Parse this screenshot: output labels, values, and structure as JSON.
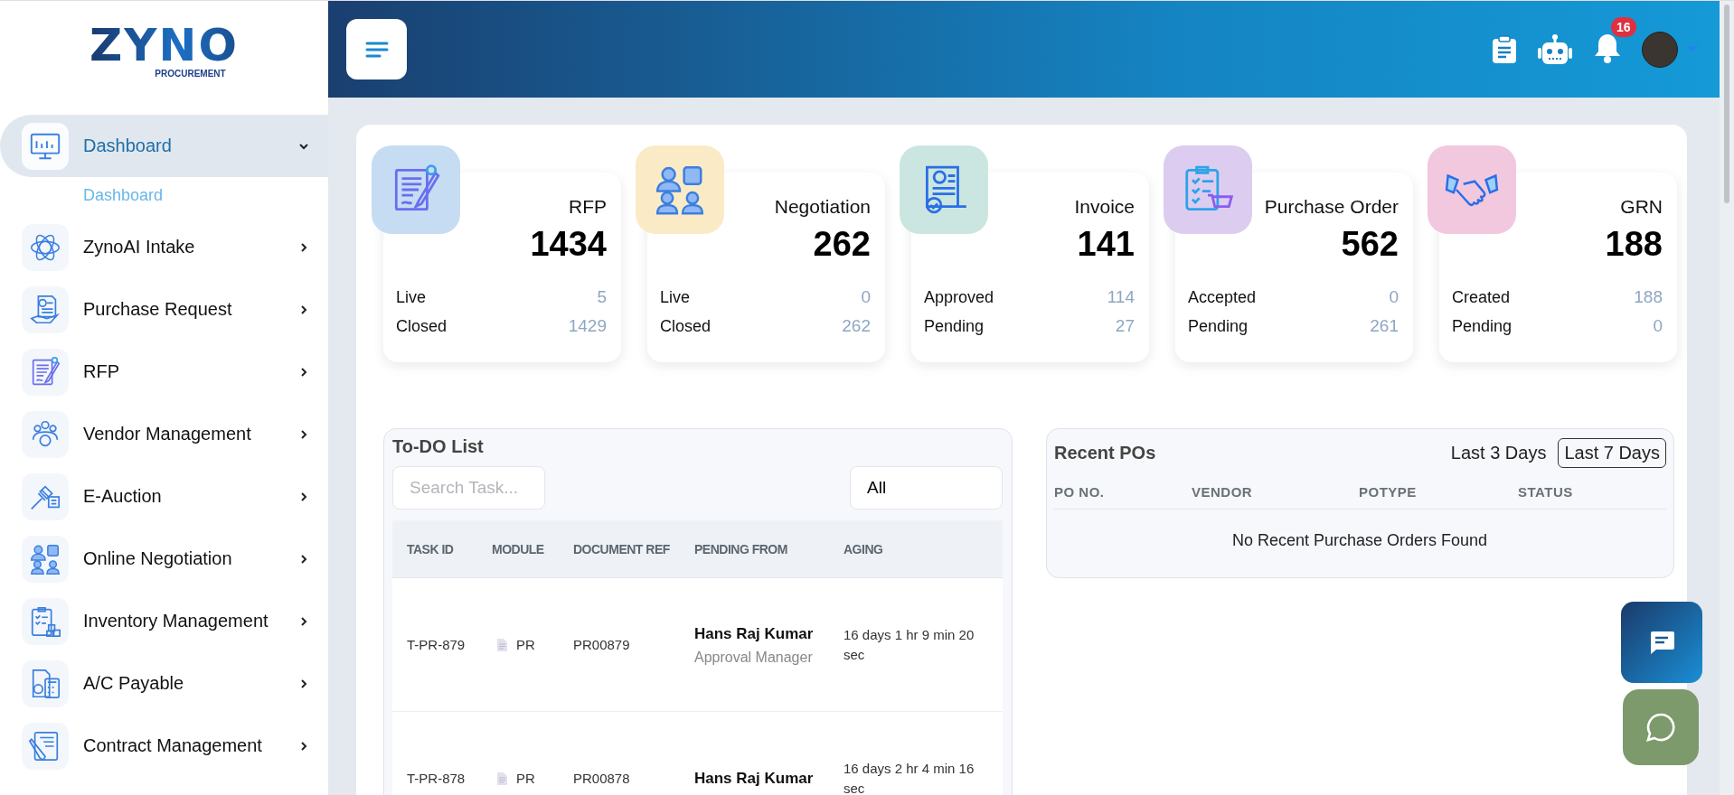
{
  "logo": {
    "wordmark": "ZYNO",
    "tagline": "PROCUREMENT"
  },
  "sidebar": {
    "items": [
      {
        "label": "Dashboard",
        "selected": true,
        "expanded": true,
        "children": [
          {
            "label": "Dashboard"
          }
        ]
      },
      {
        "label": "ZynoAI Intake",
        "selected": false,
        "expanded": false
      },
      {
        "label": "Purchase Request",
        "selected": false,
        "expanded": false
      },
      {
        "label": "RFP",
        "selected": false,
        "expanded": false
      },
      {
        "label": "Vendor Management",
        "selected": false,
        "expanded": false
      },
      {
        "label": "E-Auction",
        "selected": false,
        "expanded": false
      },
      {
        "label": "Online Negotiation",
        "selected": false,
        "expanded": false
      },
      {
        "label": "Inventory Management",
        "selected": false,
        "expanded": false
      },
      {
        "label": "A/C Payable",
        "selected": false,
        "expanded": false
      },
      {
        "label": "Contract Management",
        "selected": false,
        "expanded": false
      }
    ]
  },
  "header": {
    "notification_count": "16"
  },
  "stats": [
    {
      "title": "RFP",
      "total": "1434",
      "color": "#c5dcf3",
      "rows": [
        {
          "label": "Live",
          "value": "5"
        },
        {
          "label": "Closed",
          "value": "1429"
        }
      ]
    },
    {
      "title": "Negotiation",
      "total": "262",
      "color": "#faebc6",
      "rows": [
        {
          "label": "Live",
          "value": "0"
        },
        {
          "label": "Closed",
          "value": "262"
        }
      ]
    },
    {
      "title": "Invoice",
      "total": "141",
      "color": "#cbe6e0",
      "rows": [
        {
          "label": "Approved",
          "value": "114"
        },
        {
          "label": "Pending",
          "value": "27"
        }
      ]
    },
    {
      "title": "Purchase Order",
      "total": "562",
      "color": "#dccdf0",
      "rows": [
        {
          "label": "Accepted",
          "value": "0"
        },
        {
          "label": "Pending",
          "value": "261"
        }
      ]
    },
    {
      "title": "GRN",
      "total": "188",
      "color": "#f1c8de",
      "rows": [
        {
          "label": "Created",
          "value": "188"
        },
        {
          "label": "Pending",
          "value": "0"
        }
      ]
    }
  ],
  "todo": {
    "title": "To-DO List",
    "search": {
      "placeholder": "Search Task..."
    },
    "filter": {
      "value": "All"
    },
    "columns": [
      "TASK ID",
      "MODULE",
      "DOCUMENT REF",
      "PENDING FROM",
      "AGING"
    ],
    "rows": [
      {
        "task_id": "T-PR-879",
        "module": "PR",
        "document_ref": "PR00879",
        "pending_name": "Hans Raj Kumar",
        "pending_role": "Approval Manager",
        "aging": "16 days 1 hr 9 min 20 sec"
      },
      {
        "task_id": "T-PR-878",
        "module": "PR",
        "document_ref": "PR00878",
        "pending_name": "Hans Raj Kumar",
        "aging": "16 days 2 hr 4 min 16 sec"
      }
    ]
  },
  "recent_pos": {
    "title": "Recent POs",
    "ranges": [
      {
        "label": "Last 3 Days",
        "selected": false
      },
      {
        "label": "Last 7 Days",
        "selected": true
      }
    ],
    "columns": [
      "PO NO.",
      "VENDOR",
      "POTYPE",
      "STATUS"
    ],
    "empty_message": "No Recent Purchase Orders Found"
  }
}
